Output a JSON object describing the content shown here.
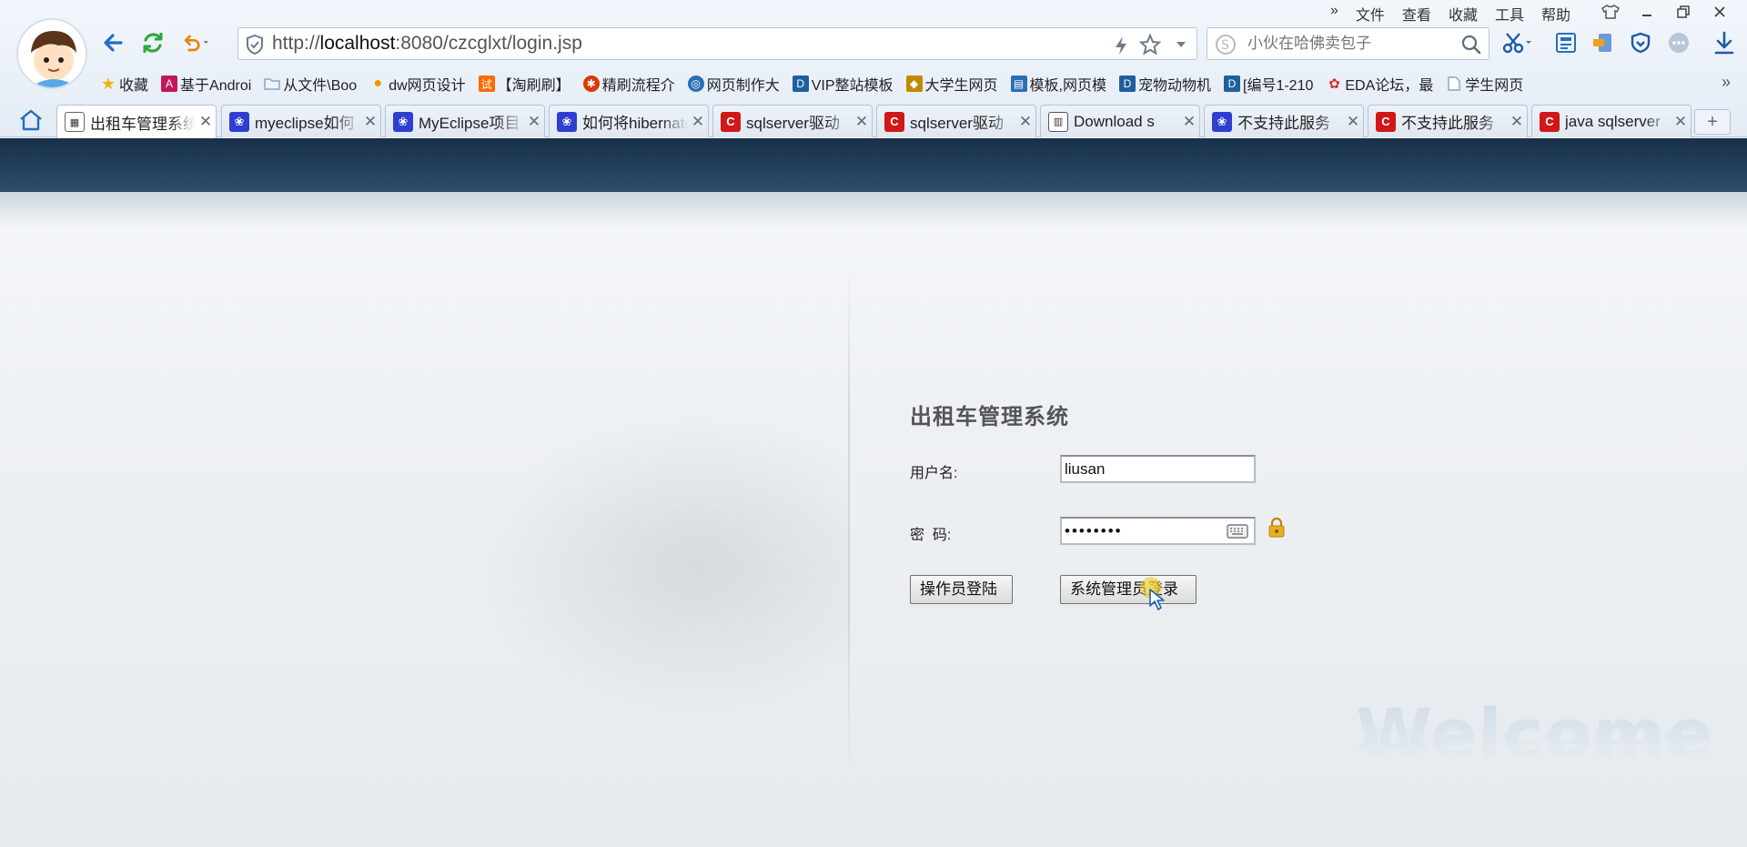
{
  "browser": {
    "address_url_prefix": "http://",
    "address_url_host": "localhost",
    "address_url_rest": ":8080/czcglxt/login.jsp",
    "search_placeholder": "小伙在哈佛卖包子",
    "top_menu": [
      "»",
      "文件",
      "查看",
      "收藏",
      "工具",
      "帮助"
    ],
    "bookmarks": [
      {
        "label": "收藏",
        "icon": "star-icon",
        "color": "#f0b400"
      },
      {
        "label": "基于Androi",
        "icon": "bookmark-site-icon",
        "color": "#c2185b"
      },
      {
        "label": "从文件\\Boo",
        "icon": "folder-icon",
        "color": "#8aa7c8"
      },
      {
        "label": "dw网页设计",
        "icon": "sina-icon",
        "color": "#e89a00"
      },
      {
        "label": "【淘刷刷】",
        "icon": "taobao-icon",
        "color": "#ff6a00"
      },
      {
        "label": "精刷流程介",
        "icon": "badge-icon",
        "color": "#d93a00"
      },
      {
        "label": "网页制作大",
        "icon": "web-icon",
        "color": "#2a6fb5"
      },
      {
        "label": "VIP整站模板",
        "icon": "d-logo-icon",
        "color": "#1f5f9e"
      },
      {
        "label": "大学生网页",
        "icon": "cube-icon",
        "color": "#c08a00"
      },
      {
        "label": "模板,网页模",
        "icon": "template-icon",
        "color": "#2a6fb5"
      },
      {
        "label": "宠物动物机",
        "icon": "d-logo-icon",
        "color": "#1f5f9e"
      },
      {
        "label": "[编号1-210",
        "icon": "d-logo-icon",
        "color": "#1f5f9e"
      },
      {
        "label": "EDA论坛，最",
        "icon": "eda-icon",
        "color": "#d32f2f"
      },
      {
        "label": "学生网页",
        "icon": "page-icon",
        "color": "#90a4ae"
      }
    ],
    "tabs": [
      {
        "label": "出租车管理系统",
        "icon": "page-thumb-icon",
        "color": "#ffffff",
        "active": true
      },
      {
        "label": "myeclipse如何",
        "icon": "baidu-paw-icon",
        "color": "#2e3fd0"
      },
      {
        "label": "MyEclipse项目",
        "icon": "baidu-paw-icon",
        "color": "#2e3fd0"
      },
      {
        "label": "如何将hibernate",
        "icon": "baidu-paw-icon",
        "color": "#2e3fd0"
      },
      {
        "label": "sqlserver驱动",
        "icon": "csdn-c-icon",
        "color": "#d01818"
      },
      {
        "label": "sqlserver驱动",
        "icon": "csdn-c-icon",
        "color": "#d01818"
      },
      {
        "label": "Download s",
        "icon": "doc-icon",
        "color": "#ffffff"
      },
      {
        "label": "不支持此服务",
        "icon": "baidu-paw-icon",
        "color": "#2e3fd0"
      },
      {
        "label": "不支持此服务",
        "icon": "csdn-c-icon",
        "color": "#d01818"
      },
      {
        "label": "java sqlserver",
        "icon": "csdn-c-icon",
        "color": "#d01818"
      }
    ],
    "new_tab_label": "+",
    "bookmarks_more": "»"
  },
  "page": {
    "system_title": "出租车管理系统",
    "username_label": "用户名:",
    "username_value": "liusan",
    "password_label": "密  码:",
    "password_value": "••••••••",
    "operator_login_label": "操作员登陆",
    "admin_login_label": "系统管理员登录",
    "welcome_text": "Welcome",
    "colors": {
      "header_band": "#1f3a55",
      "title_text": "#555555"
    }
  }
}
